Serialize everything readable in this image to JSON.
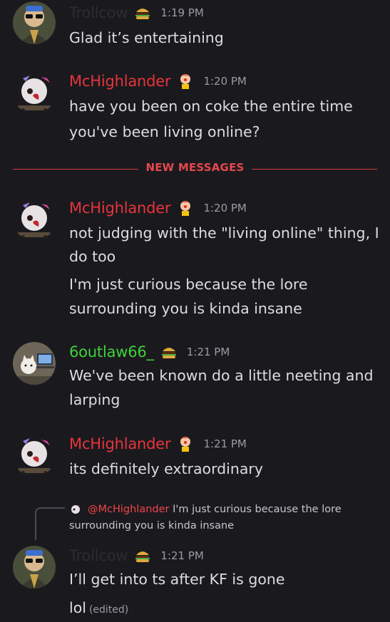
{
  "colors": {
    "background": "#1a1a1e",
    "trollcow_name": "#2b2d31",
    "mchighlander_name": "#e8333b",
    "outlaw_name": "#3fd13a",
    "divider": "#e5484d",
    "timestamp": "#9a9ba3"
  },
  "messages": [
    {
      "author": "Trollcow",
      "badge": "burger-icon",
      "time": "1:19 PM",
      "lines": [
        "Glad it’s entertaining"
      ]
    },
    {
      "author": "McHighlander",
      "badge": "clown-icon",
      "time": "1:20 PM",
      "lines": [
        "have you been on coke the entire time",
        "you've been living online?"
      ]
    },
    {
      "author": "McHighlander",
      "badge": "clown-icon",
      "time": "1:20 PM",
      "lines": [
        "not judging with the \"living online\" thing, I",
        "do too",
        "I'm just curious because the lore",
        "surrounding you is kinda insane"
      ]
    },
    {
      "author": "6outlaw66_",
      "badge": "burger-icon",
      "time": "1:21 PM",
      "lines": [
        "We've been known do a little neeting and",
        "larping"
      ]
    },
    {
      "author": "McHighlander",
      "badge": "clown-icon",
      "time": "1:21 PM",
      "lines": [
        "its definitely extraordinary"
      ]
    },
    {
      "author": "Trollcow",
      "badge": "burger-icon",
      "time": "1:21 PM",
      "lines": [
        "I’ll get into ts after KF is gone",
        "lol"
      ],
      "edited": "(edited)"
    }
  ],
  "divider_label": "NEW MESSAGES",
  "reply": {
    "mention": "@McHighlander",
    "text_line1": "I'm just curious because the lore",
    "text_line2": "surrounding you is kinda insane"
  }
}
